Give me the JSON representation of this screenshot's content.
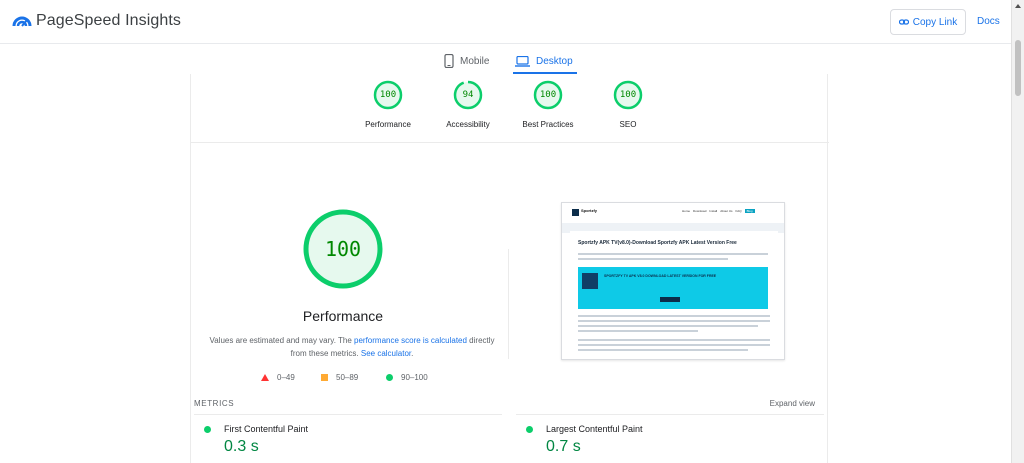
{
  "app": {
    "title": "PageSpeed Insights"
  },
  "header": {
    "copy_link_label": "Copy Link",
    "docs_label": "Docs"
  },
  "tabs": [
    {
      "label": "Mobile",
      "icon": "phone-icon",
      "active": false
    },
    {
      "label": "Desktop",
      "icon": "laptop-icon",
      "active": true
    }
  ],
  "scores": [
    {
      "label": "Performance",
      "value": "100",
      "fraction": 1.0
    },
    {
      "label": "Accessibility",
      "value": "94",
      "fraction": 0.94
    },
    {
      "label": "Best Practices",
      "value": "100",
      "fraction": 1.0
    },
    {
      "label": "SEO",
      "value": "100",
      "fraction": 1.0
    }
  ],
  "performance": {
    "score": "100",
    "title": "Performance",
    "desc_prefix": "Values are estimated and may vary. The ",
    "desc_link1": "performance score is calculated",
    "desc_middle": " directly from these metrics. ",
    "desc_link2": "See calculator",
    "desc_suffix": "."
  },
  "legend": [
    {
      "range": "0–49",
      "shape": "triangle",
      "color": "#ff3333"
    },
    {
      "range": "50–89",
      "shape": "square",
      "color": "#ffaa33"
    },
    {
      "range": "90–100",
      "shape": "circle",
      "color": "#0cce6b"
    }
  ],
  "thumbnail": {
    "brand": "Sportzfy",
    "menu": [
      "Home",
      "Download",
      "Install",
      "About Us",
      "FAQ",
      "Blog"
    ],
    "heading": "Sportzfy APK TV(v8.0)-Download Sportzfy APK Latest Version Free",
    "banner_heading": "SPORTZFY TV APK V8.0 DOWNLOAD LATEST VERSION FOR FREE"
  },
  "metrics": {
    "section_label": "METRICS",
    "expand_label": "Expand view",
    "items": [
      {
        "name": "First Contentful Paint",
        "value": "0.3 s"
      },
      {
        "name": "Largest Contentful Paint",
        "value": "0.7 s"
      }
    ]
  },
  "colors": {
    "accent": "#1a73e8",
    "pass": "#0cce6b",
    "pass_text": "#008800",
    "gauge_bg": "#e6f9ee"
  }
}
